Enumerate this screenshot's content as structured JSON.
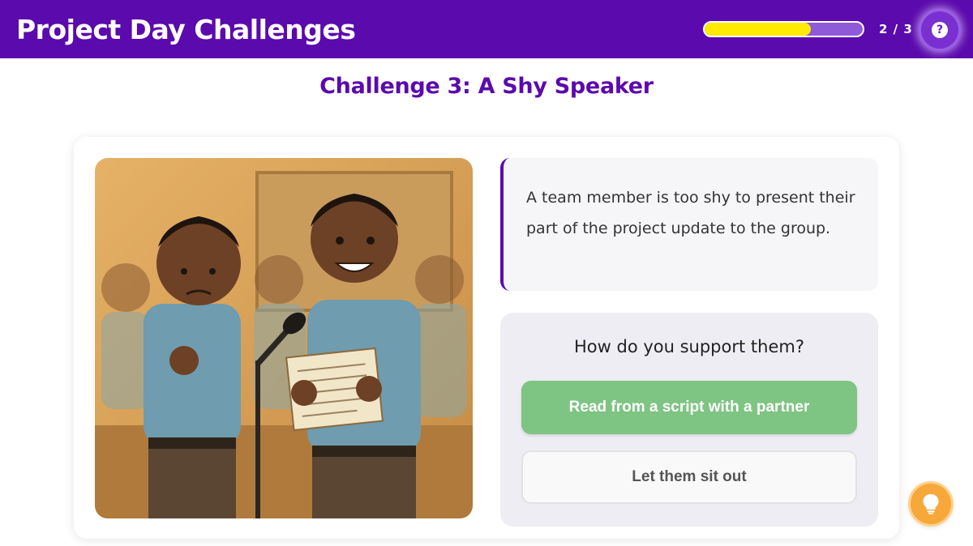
{
  "header": {
    "title": "Project Day Challenges",
    "progress_fraction": 0.67,
    "progress_text": "2 / 3",
    "help_icon": "question-circle-icon",
    "help_glyph": "?"
  },
  "challenge": {
    "title": "Challenge 3: A Shy Speaker",
    "description": "A team member is too shy to present their part of the project update to the group.",
    "question": "How do you support them?",
    "choices": [
      {
        "label": "Read from a script with a partner",
        "style": "primary"
      },
      {
        "label": "Let them sit out",
        "style": "secondary"
      }
    ]
  },
  "hint": {
    "icon": "lightbulb-icon"
  },
  "colors": {
    "brand_purple": "#5b0aad",
    "progress_yellow": "#ffea00",
    "choice_green": "#7ec482",
    "hint_orange": "#f7a83a"
  }
}
